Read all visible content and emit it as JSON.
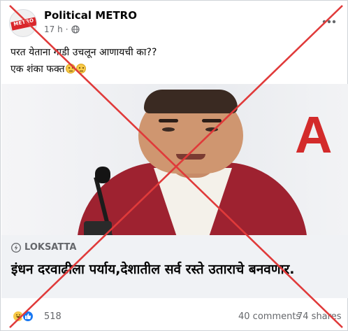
{
  "post": {
    "page_name": "Political METRO",
    "time": "17 h",
    "separator": "·",
    "text_line1": "परत येताना गाडी उचलून आणायची का??",
    "text_line2": "एक शंका फक्त",
    "avatar_text": "POLITICAL METRO",
    "icons": [
      "globe-icon",
      "more-options-icon",
      "emoji-icon"
    ]
  },
  "link_preview": {
    "source": "LOKSATTA",
    "headline": "इंधन दरवाढीला पर्याय,देशातील सर्व रस्ते उताराचे बनवणार.",
    "banner_letter": "A",
    "icons": [
      "bolt-icon"
    ]
  },
  "footer": {
    "reaction_count": "518",
    "comments": "40 comments",
    "shares": "74 shares",
    "icons": [
      "haha-reaction-icon",
      "like-reaction-icon"
    ]
  },
  "overlay": {
    "mark": "cross-out",
    "color": "#e03a3a"
  },
  "colors": {
    "link_card_bg": "#f0f2f5",
    "meta_text": "#65676b",
    "like_blue": "#1877f2"
  }
}
